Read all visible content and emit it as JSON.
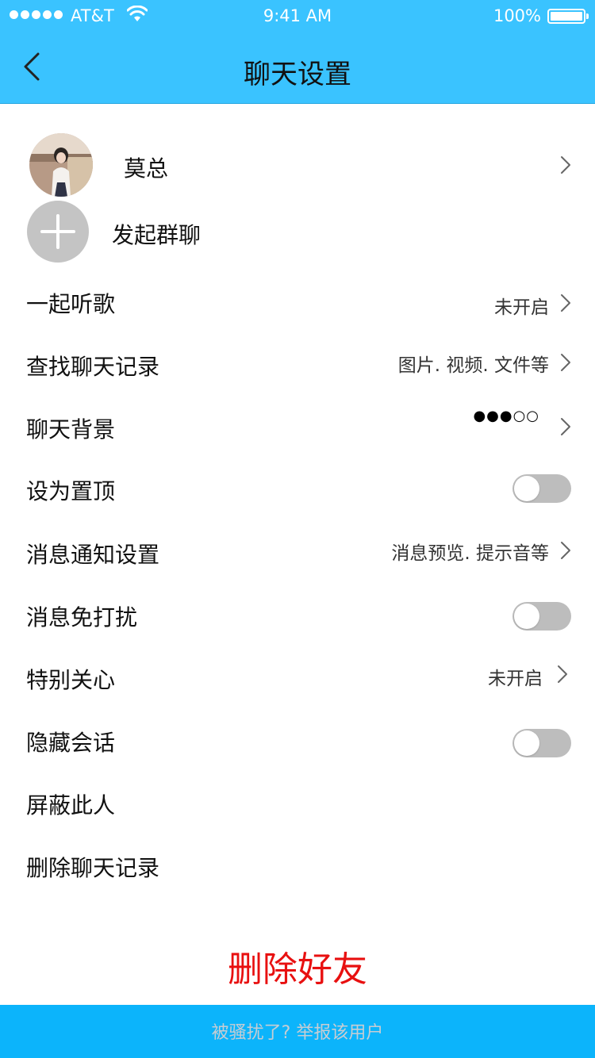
{
  "status_bar": {
    "carrier": "AT&T",
    "time": "9:41 AM",
    "battery": "100%"
  },
  "nav": {
    "title": "聊天设置"
  },
  "profile": {
    "name": "莫总"
  },
  "group_chat": {
    "label": "发起群聊"
  },
  "settings": {
    "listen_together": {
      "label": "一起听歌",
      "value": "未开启"
    },
    "search_history": {
      "label": "查找聊天记录",
      "value": "图片. 视频. 文件等"
    },
    "chat_background": {
      "label": "聊天背景",
      "value": "●●●○○"
    },
    "pin_to_top": {
      "label": "设为置顶",
      "enabled": false
    },
    "notification_settings": {
      "label": "消息通知设置",
      "value": "消息预览. 提示音等"
    },
    "do_not_disturb": {
      "label": "消息免打扰",
      "enabled": false
    },
    "special_care": {
      "label": "特别关心",
      "value": "未开启"
    },
    "hide_conversation": {
      "label": "隐藏会话",
      "enabled": false
    },
    "block_user": {
      "label": "屏蔽此人"
    },
    "delete_history": {
      "label": "删除聊天记录"
    }
  },
  "actions": {
    "delete_friend": "删除好友",
    "report": "被骚扰了? 举报该用户"
  },
  "colors": {
    "header": "#3ac3ff",
    "report_bar": "#0cb4fb",
    "danger": "#e81010",
    "toggle_off": "#bdbdbd"
  }
}
